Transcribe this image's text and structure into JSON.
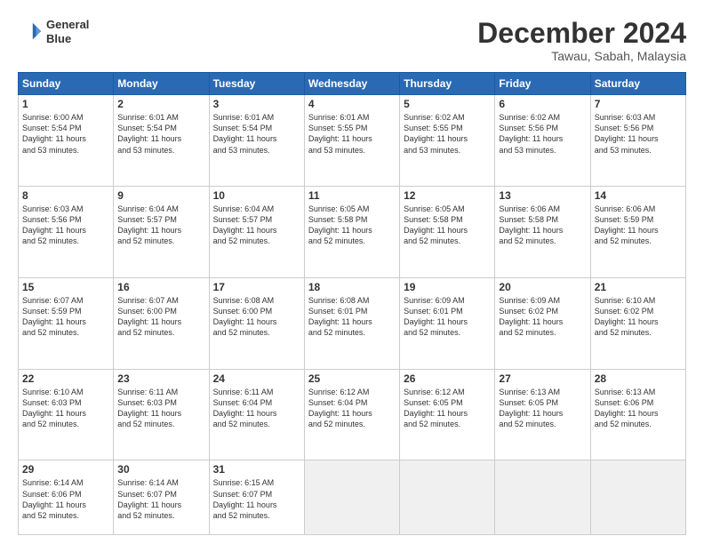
{
  "header": {
    "logo_line1": "General",
    "logo_line2": "Blue",
    "month": "December 2024",
    "location": "Tawau, Sabah, Malaysia"
  },
  "weekdays": [
    "Sunday",
    "Monday",
    "Tuesday",
    "Wednesday",
    "Thursday",
    "Friday",
    "Saturday"
  ],
  "weeks": [
    [
      {
        "day": "1",
        "info": "Sunrise: 6:00 AM\nSunset: 5:54 PM\nDaylight: 11 hours\nand 53 minutes."
      },
      {
        "day": "2",
        "info": "Sunrise: 6:01 AM\nSunset: 5:54 PM\nDaylight: 11 hours\nand 53 minutes."
      },
      {
        "day": "3",
        "info": "Sunrise: 6:01 AM\nSunset: 5:54 PM\nDaylight: 11 hours\nand 53 minutes."
      },
      {
        "day": "4",
        "info": "Sunrise: 6:01 AM\nSunset: 5:55 PM\nDaylight: 11 hours\nand 53 minutes."
      },
      {
        "day": "5",
        "info": "Sunrise: 6:02 AM\nSunset: 5:55 PM\nDaylight: 11 hours\nand 53 minutes."
      },
      {
        "day": "6",
        "info": "Sunrise: 6:02 AM\nSunset: 5:56 PM\nDaylight: 11 hours\nand 53 minutes."
      },
      {
        "day": "7",
        "info": "Sunrise: 6:03 AM\nSunset: 5:56 PM\nDaylight: 11 hours\nand 53 minutes."
      }
    ],
    [
      {
        "day": "8",
        "info": "Sunrise: 6:03 AM\nSunset: 5:56 PM\nDaylight: 11 hours\nand 52 minutes."
      },
      {
        "day": "9",
        "info": "Sunrise: 6:04 AM\nSunset: 5:57 PM\nDaylight: 11 hours\nand 52 minutes."
      },
      {
        "day": "10",
        "info": "Sunrise: 6:04 AM\nSunset: 5:57 PM\nDaylight: 11 hours\nand 52 minutes."
      },
      {
        "day": "11",
        "info": "Sunrise: 6:05 AM\nSunset: 5:58 PM\nDaylight: 11 hours\nand 52 minutes."
      },
      {
        "day": "12",
        "info": "Sunrise: 6:05 AM\nSunset: 5:58 PM\nDaylight: 11 hours\nand 52 minutes."
      },
      {
        "day": "13",
        "info": "Sunrise: 6:06 AM\nSunset: 5:58 PM\nDaylight: 11 hours\nand 52 minutes."
      },
      {
        "day": "14",
        "info": "Sunrise: 6:06 AM\nSunset: 5:59 PM\nDaylight: 11 hours\nand 52 minutes."
      }
    ],
    [
      {
        "day": "15",
        "info": "Sunrise: 6:07 AM\nSunset: 5:59 PM\nDaylight: 11 hours\nand 52 minutes."
      },
      {
        "day": "16",
        "info": "Sunrise: 6:07 AM\nSunset: 6:00 PM\nDaylight: 11 hours\nand 52 minutes."
      },
      {
        "day": "17",
        "info": "Sunrise: 6:08 AM\nSunset: 6:00 PM\nDaylight: 11 hours\nand 52 minutes."
      },
      {
        "day": "18",
        "info": "Sunrise: 6:08 AM\nSunset: 6:01 PM\nDaylight: 11 hours\nand 52 minutes."
      },
      {
        "day": "19",
        "info": "Sunrise: 6:09 AM\nSunset: 6:01 PM\nDaylight: 11 hours\nand 52 minutes."
      },
      {
        "day": "20",
        "info": "Sunrise: 6:09 AM\nSunset: 6:02 PM\nDaylight: 11 hours\nand 52 minutes."
      },
      {
        "day": "21",
        "info": "Sunrise: 6:10 AM\nSunset: 6:02 PM\nDaylight: 11 hours\nand 52 minutes."
      }
    ],
    [
      {
        "day": "22",
        "info": "Sunrise: 6:10 AM\nSunset: 6:03 PM\nDaylight: 11 hours\nand 52 minutes."
      },
      {
        "day": "23",
        "info": "Sunrise: 6:11 AM\nSunset: 6:03 PM\nDaylight: 11 hours\nand 52 minutes."
      },
      {
        "day": "24",
        "info": "Sunrise: 6:11 AM\nSunset: 6:04 PM\nDaylight: 11 hours\nand 52 minutes."
      },
      {
        "day": "25",
        "info": "Sunrise: 6:12 AM\nSunset: 6:04 PM\nDaylight: 11 hours\nand 52 minutes."
      },
      {
        "day": "26",
        "info": "Sunrise: 6:12 AM\nSunset: 6:05 PM\nDaylight: 11 hours\nand 52 minutes."
      },
      {
        "day": "27",
        "info": "Sunrise: 6:13 AM\nSunset: 6:05 PM\nDaylight: 11 hours\nand 52 minutes."
      },
      {
        "day": "28",
        "info": "Sunrise: 6:13 AM\nSunset: 6:06 PM\nDaylight: 11 hours\nand 52 minutes."
      }
    ],
    [
      {
        "day": "29",
        "info": "Sunrise: 6:14 AM\nSunset: 6:06 PM\nDaylight: 11 hours\nand 52 minutes."
      },
      {
        "day": "30",
        "info": "Sunrise: 6:14 AM\nSunset: 6:07 PM\nDaylight: 11 hours\nand 52 minutes."
      },
      {
        "day": "31",
        "info": "Sunrise: 6:15 AM\nSunset: 6:07 PM\nDaylight: 11 hours\nand 52 minutes."
      },
      null,
      null,
      null,
      null
    ]
  ]
}
